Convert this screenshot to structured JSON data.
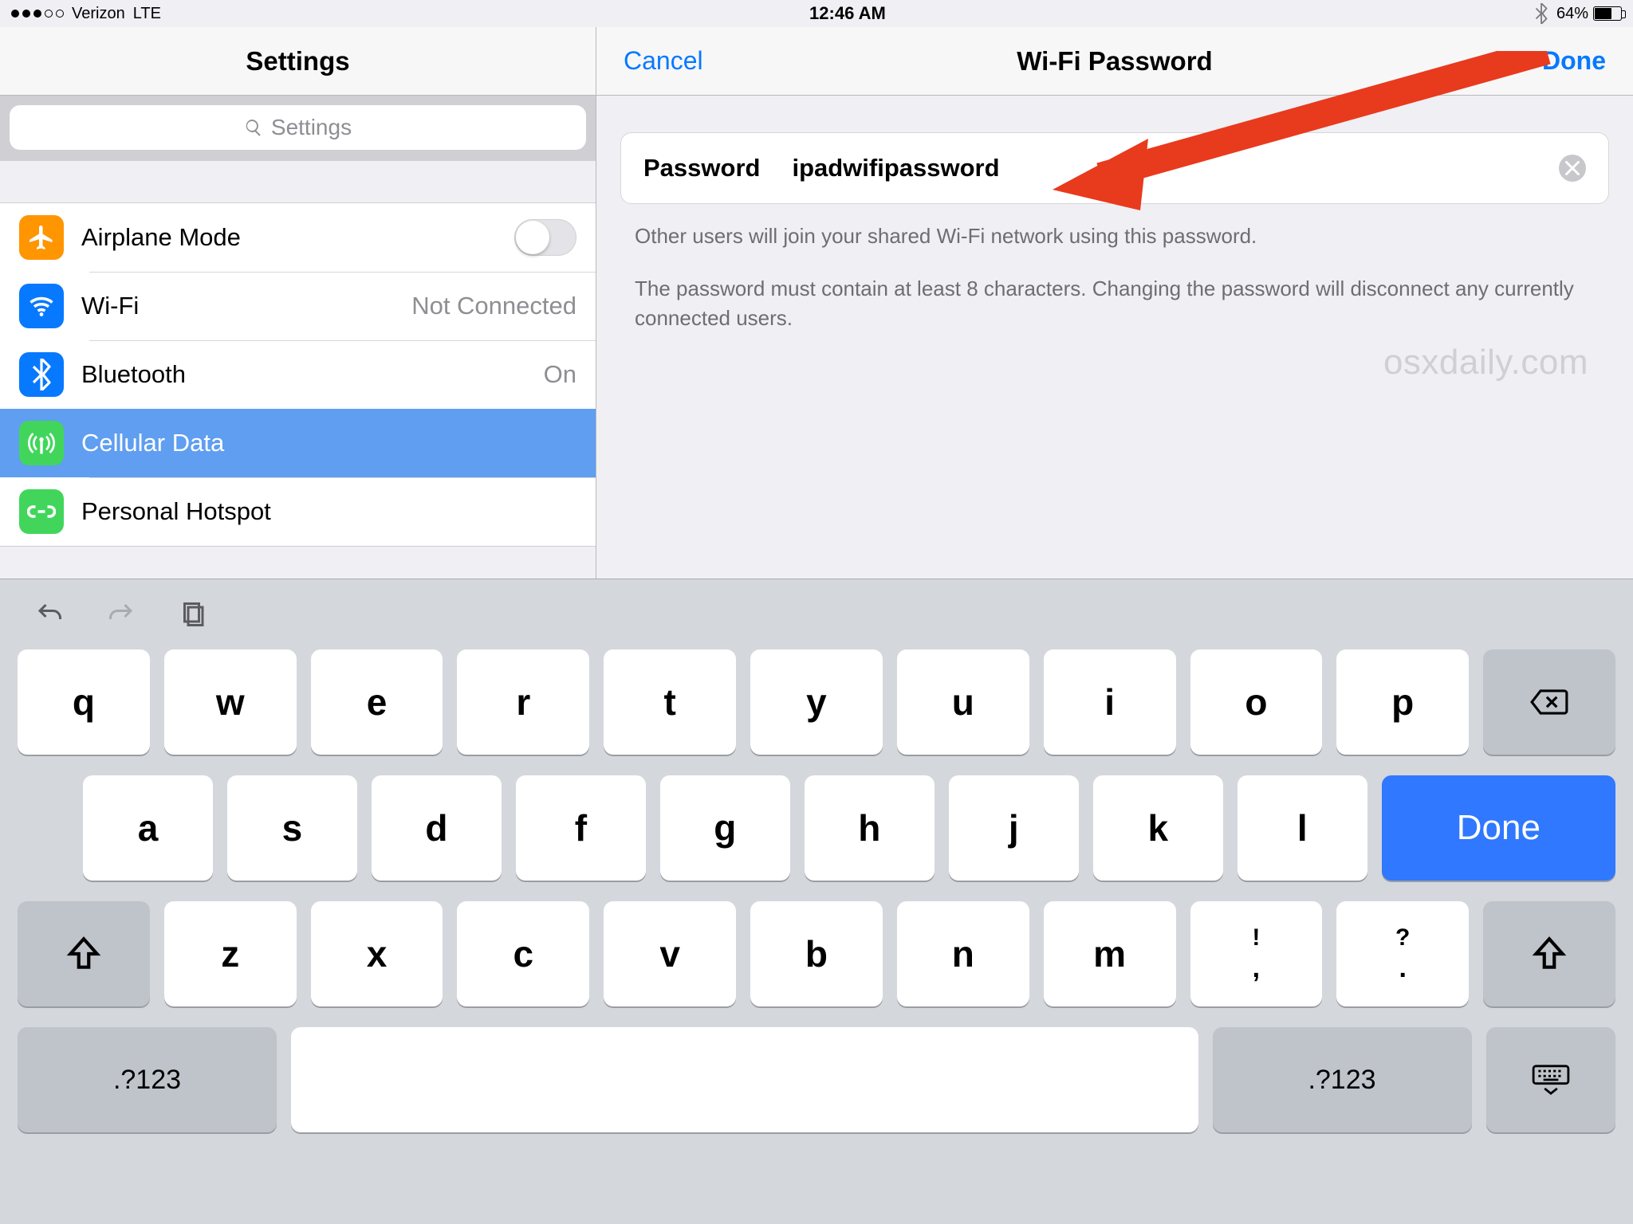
{
  "statusbar": {
    "carrier": "Verizon",
    "network": "LTE",
    "time": "12:46 AM",
    "battery_pct": "64%"
  },
  "sidebar": {
    "title": "Settings",
    "search_placeholder": "Settings",
    "items": [
      {
        "label": "Airplane Mode",
        "value": ""
      },
      {
        "label": "Wi-Fi",
        "value": "Not Connected"
      },
      {
        "label": "Bluetooth",
        "value": "On"
      },
      {
        "label": "Cellular Data",
        "value": ""
      },
      {
        "label": "Personal Hotspot",
        "value": ""
      }
    ]
  },
  "detail": {
    "cancel": "Cancel",
    "done": "Done",
    "title": "Wi-Fi Password",
    "field_label": "Password",
    "field_value": "ipadwifipassword",
    "hint1": "Other users will join your shared Wi-Fi network using this password.",
    "hint2": "The password must contain at least 8 characters. Changing the password will disconnect any currently connected users.",
    "watermark": "osxdaily.com"
  },
  "keyboard": {
    "row1": [
      "q",
      "w",
      "e",
      "r",
      "t",
      "y",
      "u",
      "i",
      "o",
      "p"
    ],
    "row2": [
      "a",
      "s",
      "d",
      "f",
      "g",
      "h",
      "j",
      "k",
      "l"
    ],
    "row3": [
      "z",
      "x",
      "c",
      "v",
      "b",
      "n",
      "m"
    ],
    "punct1_top": "!",
    "punct1_bot": ",",
    "punct2_top": "?",
    "punct2_bot": ".",
    "numlabel": ".?123",
    "done": "Done"
  }
}
